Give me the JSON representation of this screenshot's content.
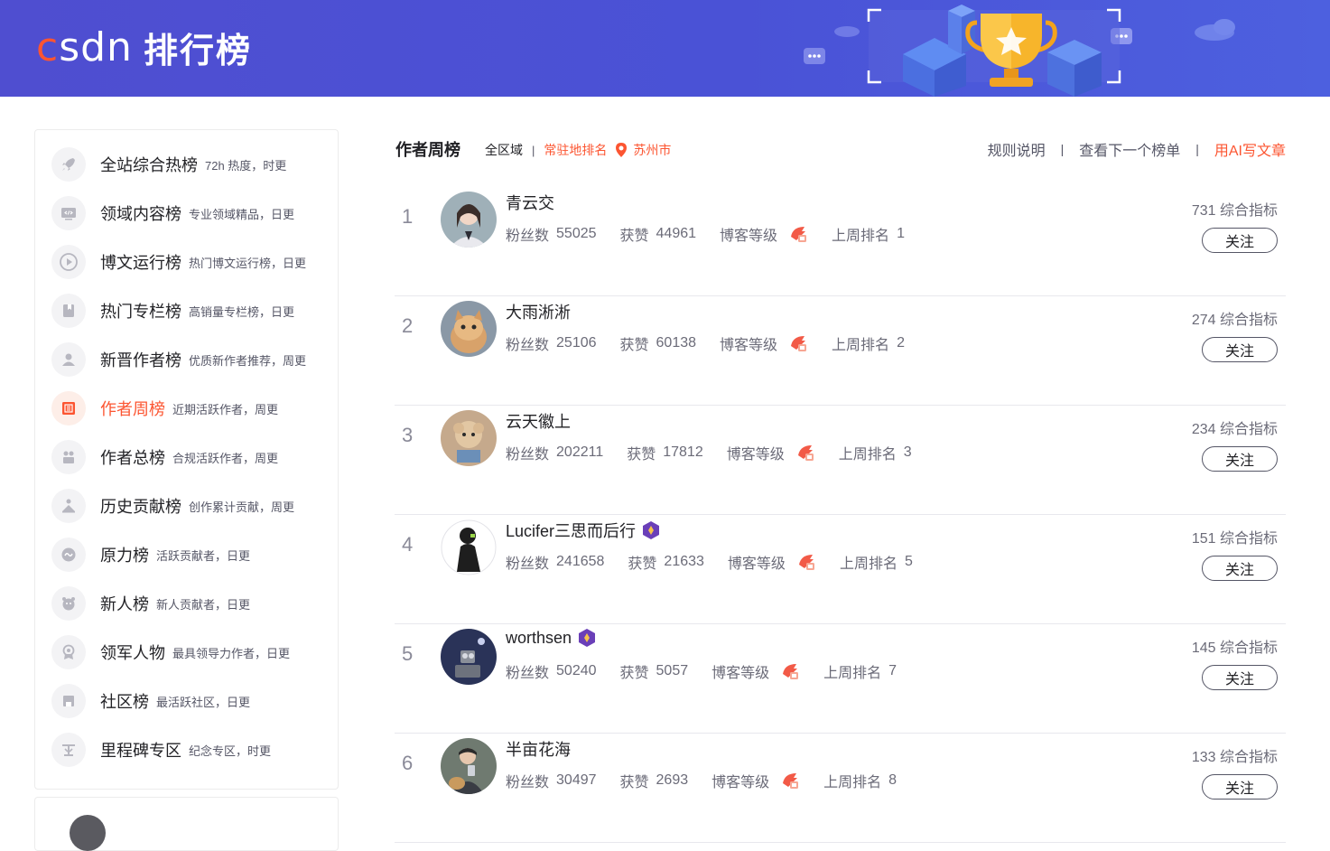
{
  "header": {
    "logo_text": "CSDN",
    "title": "排行榜"
  },
  "sidebar": {
    "items": [
      {
        "label": "全站综合热榜",
        "desc": "72h 热度，时更",
        "icon": "rocket-icon"
      },
      {
        "label": "领域内容榜",
        "desc": "专业领域精品，日更",
        "icon": "code-icon"
      },
      {
        "label": "博文运行榜",
        "desc": "热门博文运行榜，日更",
        "icon": "play-icon"
      },
      {
        "label": "热门专栏榜",
        "desc": "高销量专栏榜，日更",
        "icon": "bookmark-icon"
      },
      {
        "label": "新晋作者榜",
        "desc": "优质新作者推荐，周更",
        "icon": "user-icon"
      },
      {
        "label": "作者周榜",
        "desc": "近期活跃作者，周更",
        "icon": "calendar-icon",
        "active": true
      },
      {
        "label": "作者总榜",
        "desc": "合规活跃作者，周更",
        "icon": "group-icon"
      },
      {
        "label": "历史贡献榜",
        "desc": "创作累计贡献，周更",
        "icon": "contribution-icon"
      },
      {
        "label": "原力榜",
        "desc": "活跃贡献者，日更",
        "icon": "force-icon"
      },
      {
        "label": "新人榜",
        "desc": "新人贡献者，日更",
        "icon": "newbie-icon"
      },
      {
        "label": "领军人物",
        "desc": "最具领导力作者，日更",
        "icon": "medal-icon"
      },
      {
        "label": "社区榜",
        "desc": "最活跃社区，日更",
        "icon": "community-icon"
      },
      {
        "label": "里程碑专区",
        "desc": "纪念专区，时更",
        "icon": "milestone-icon"
      }
    ]
  },
  "main": {
    "title": "作者周榜",
    "region": "全区域",
    "location_label": "常驻地排名",
    "city": "苏州市",
    "toolbar": {
      "rules": "规则说明",
      "next": "查看下一个榜单",
      "ai": "用AI写文章"
    },
    "labels": {
      "fans": "粉丝数",
      "likes": "获赞",
      "level": "博客等级",
      "last_rank": "上周排名",
      "score_suffix": "综合指标",
      "follow": "关注"
    },
    "rows": [
      {
        "rank": "1",
        "name": "青云交",
        "fans": "55025",
        "likes": "44961",
        "last_rank": "1",
        "score": "731",
        "vip": false
      },
      {
        "rank": "2",
        "name": "大雨淅淅",
        "fans": "25106",
        "likes": "60138",
        "last_rank": "2",
        "score": "274",
        "vip": false
      },
      {
        "rank": "3",
        "name": "云天徽上",
        "fans": "202211",
        "likes": "17812",
        "last_rank": "3",
        "score": "234",
        "vip": false
      },
      {
        "rank": "4",
        "name": "Lucifer三思而后行",
        "fans": "241658",
        "likes": "21633",
        "last_rank": "5",
        "score": "151",
        "vip": true
      },
      {
        "rank": "5",
        "name": "worthsen",
        "fans": "50240",
        "likes": "5057",
        "last_rank": "7",
        "score": "145",
        "vip": true
      },
      {
        "rank": "6",
        "name": "半亩花海",
        "fans": "30497",
        "likes": "2693",
        "last_rank": "8",
        "score": "133",
        "vip": false
      }
    ]
  },
  "colors": {
    "banner": "#4f4ed0",
    "accent": "#fc5531",
    "text": "#222226",
    "muted": "#6b6b78"
  }
}
